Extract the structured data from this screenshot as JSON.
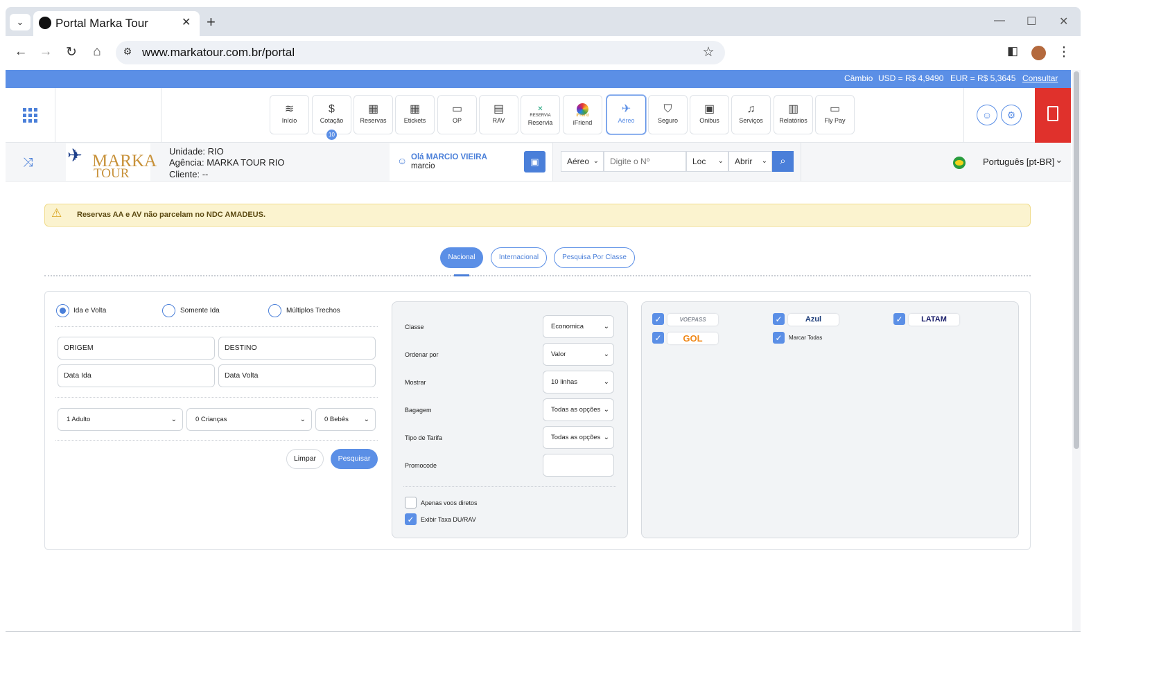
{
  "browser": {
    "tab_title": "Portal Marka Tour",
    "url": "www.markatour.com.br/portal"
  },
  "topbar": {
    "cambio": "Câmbio",
    "usd": "USD = R$ 4,9490",
    "eur": "EUR = R$ 5,3645",
    "consultar": "Consultar"
  },
  "nav": {
    "items": [
      {
        "label": "Início",
        "icon": "layers-icon"
      },
      {
        "label": "Cotação",
        "icon": "dollar-icon",
        "badge": "10"
      },
      {
        "label": "Reservas",
        "icon": "calendar-icon"
      },
      {
        "label": "Etickets",
        "icon": "calendar-icon"
      },
      {
        "label": "OP",
        "icon": "ticket-icon"
      },
      {
        "label": "RAV",
        "icon": "receipt-icon"
      },
      {
        "label": "Reservia",
        "icon": "reservia-logo",
        "logo_text": "RESERVIA"
      },
      {
        "label": "iFriend",
        "icon": "ifriend-logo",
        "logo_text": "iFriend"
      },
      {
        "label": "Aéreo",
        "icon": "plane-icon",
        "active": true
      },
      {
        "label": "Seguro",
        "icon": "shield-icon"
      },
      {
        "label": "Onibus",
        "icon": "bus-icon"
      },
      {
        "label": "Serviços",
        "icon": "bell-icon"
      },
      {
        "label": "Relatórios",
        "icon": "report-icon"
      },
      {
        "label": "Fly Pay",
        "icon": "wallet-icon"
      }
    ]
  },
  "info": {
    "unidade_label": "Unidade:",
    "unidade": "RIO",
    "agencia_label": "Agência:",
    "agencia": "MARKA TOUR RIO",
    "cliente_label": "Cliente:",
    "cliente": "--",
    "logo_line1": "MARKA",
    "logo_line2": "TOUR"
  },
  "user": {
    "greeting": "Olá MARCIO VIEIRA",
    "login": "marcio"
  },
  "quick_search": {
    "type": "Aéreo",
    "placeholder": "Digite o Nº",
    "loc": "Loc",
    "action": "Abrir"
  },
  "language": "Português [pt-BR]",
  "alert": "Reservas AA e AV não parcelam no NDC AMADEUS.",
  "tabs": [
    "Nacional",
    "Internacional",
    "Pesquisa Por Classe"
  ],
  "trip": {
    "options": [
      "Ida e Volta",
      "Somente Ida",
      "Múltiplos Trechos"
    ],
    "origin": "ORIGEM",
    "destination": "DESTINO",
    "date_out": "Data Ida",
    "date_back": "Data Volta",
    "adults": "1 Adulto",
    "children": "0 Crianças",
    "babies": "0 Bebês",
    "clear": "Limpar",
    "search": "Pesquisar"
  },
  "filters": {
    "classe_label": "Classe",
    "classe": "Economica",
    "ordenar_label": "Ordenar por",
    "ordenar": "Valor",
    "mostrar_label": "Mostrar",
    "mostrar": "10 linhas",
    "bagagem_label": "Bagagem",
    "bagagem": "Todas as opções",
    "tarifa_label": "Tipo de Tarifa",
    "tarifa": "Todas as opções",
    "promocode_label": "Promocode",
    "diretos": "Apenas voos diretos",
    "exibir_taxa": "Exibir Taxa DU/RAV"
  },
  "airlines": {
    "voepass": "VOEPASS",
    "azul": "Azul",
    "latam": "LATAM",
    "gol": "GOL",
    "marcar_todas": "Marcar Todas"
  },
  "colors": {
    "accent": "#5b8fe6",
    "exit": "#e0312c",
    "alert_bg": "#fbf3cf"
  }
}
